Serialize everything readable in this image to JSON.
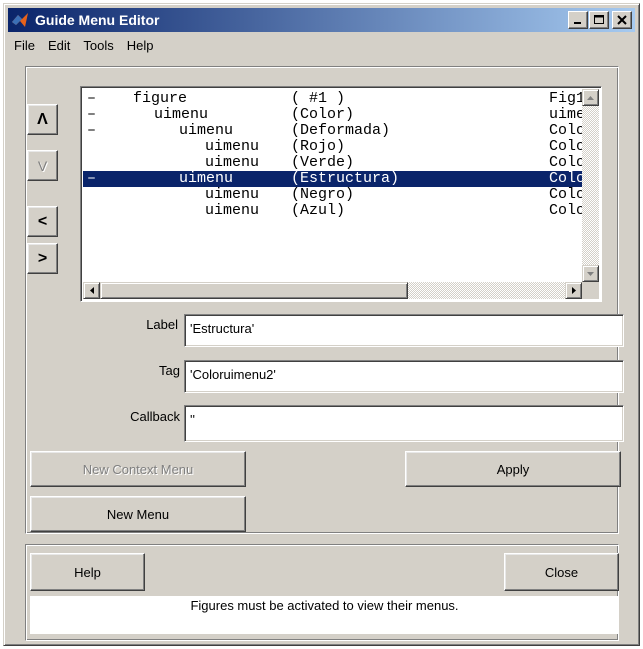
{
  "window": {
    "title": "Guide Menu Editor"
  },
  "menubar": [
    "File",
    "Edit",
    "Tools",
    "Help"
  ],
  "tree": {
    "rows": [
      {
        "dash": "–",
        "type": "figure",
        "name": "( #1 )",
        "callback": "Fig1",
        "indent": 0,
        "selected": false
      },
      {
        "dash": "–",
        "type": "uimenu",
        "name": "(Color)",
        "callback": "uime",
        "indent": 1,
        "selected": false
      },
      {
        "dash": "–",
        "type": "uimenu",
        "name": "(Deformada)",
        "callback": "Colo",
        "indent": 2,
        "selected": false
      },
      {
        "dash": "",
        "type": "uimenu",
        "name": "(Rojo)",
        "callback": "Colo",
        "indent": 3,
        "selected": false
      },
      {
        "dash": "",
        "type": "uimenu",
        "name": "(Verde)",
        "callback": "Colo",
        "indent": 3,
        "selected": false
      },
      {
        "dash": "–",
        "type": "uimenu",
        "name": "(Estructura)",
        "callback": "Colo",
        "indent": 2,
        "selected": true
      },
      {
        "dash": "",
        "type": "uimenu",
        "name": "(Negro)",
        "callback": "Colo",
        "indent": 3,
        "selected": false
      },
      {
        "dash": "",
        "type": "uimenu",
        "name": "(Azul)",
        "callback": "Colo",
        "indent": 3,
        "selected": false
      }
    ]
  },
  "arrows": {
    "up": "Λ",
    "down": "V",
    "left": "<",
    "right": ">"
  },
  "properties": {
    "label_label": "Label",
    "label_value": "'Estructura'",
    "tag_label": "Tag",
    "tag_value": "'Coloruimenu2'",
    "callback_label": "Callback",
    "callback_value": "''"
  },
  "buttons": {
    "new_context_menu": "New Context Menu",
    "apply": "Apply",
    "new_menu": "New Menu",
    "help": "Help",
    "close": "Close"
  },
  "status": "Figures must be activated to view their menus.",
  "colors": {
    "title_start": "#0a246a",
    "title_end": "#a6caf0",
    "selection": "#0a246a",
    "face": "#d4d0c8"
  },
  "icons": {
    "app": "matlab-logo-icon",
    "minimize": "minimize-icon",
    "maximize": "maximize-icon",
    "close": "close-icon"
  }
}
